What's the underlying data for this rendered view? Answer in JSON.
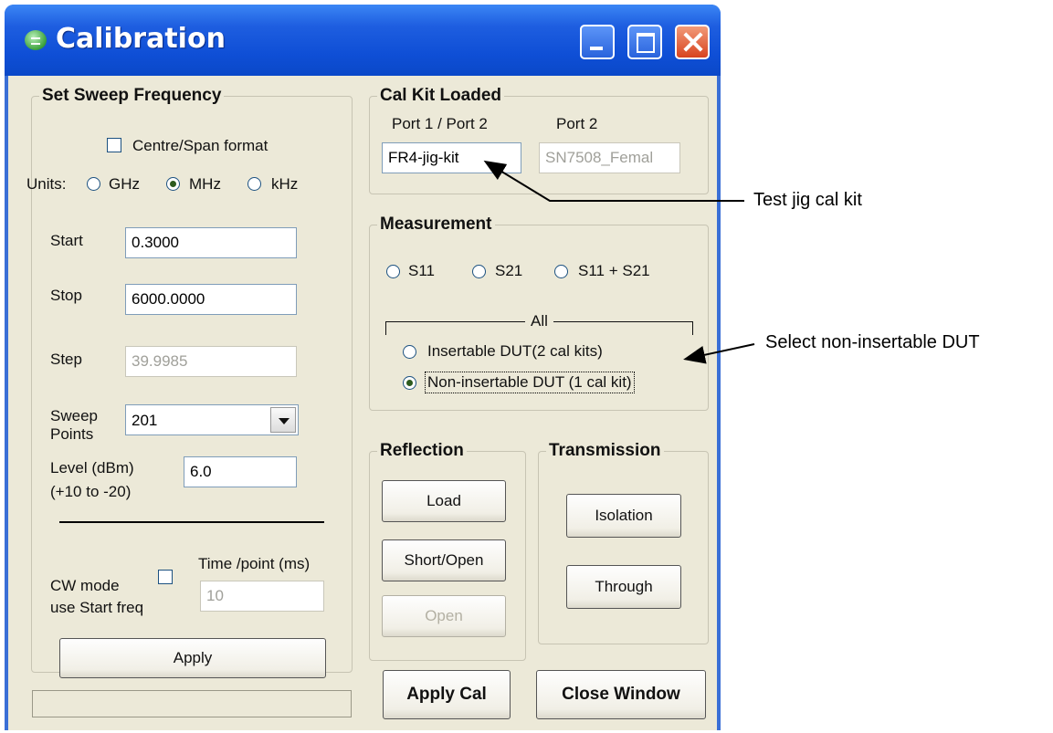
{
  "window": {
    "title": "Calibration"
  },
  "sweep": {
    "legend": "Set Sweep Frequency",
    "centre_span_label": "Centre/Span format",
    "units_label": "Units:",
    "units": [
      "GHz",
      "MHz",
      "kHz"
    ],
    "units_selected": "MHz",
    "start_label": "Start",
    "start_value": "0.3000",
    "stop_label": "Stop",
    "stop_value": "6000.0000",
    "step_label": "Step",
    "step_value": "39.9985",
    "sweep_points_label_1": "Sweep",
    "sweep_points_label_2": "Points",
    "sweep_points_value": "201",
    "level_label_1": "Level (dBm)",
    "level_label_2": "(+10 to -20)",
    "level_value": "6.0",
    "cw_label_1": "CW mode",
    "cw_label_2": "use Start freq",
    "time_label": "Time /point (ms)",
    "time_value": "10",
    "apply_label": "Apply"
  },
  "calkit": {
    "legend": "Cal Kit Loaded",
    "port1_label": "Port 1 / Port 2",
    "port2_label": "Port 2",
    "port1_value": "FR4-jig-kit",
    "port2_value": "SN7508_Femal"
  },
  "measurement": {
    "legend": "Measurement",
    "options": [
      "S11",
      "S21",
      "S11 + S21"
    ],
    "all_label": "All",
    "insertable_label": "Insertable DUT(2 cal kits)",
    "noninsertable_label": "Non-insertable DUT (1 cal kit)",
    "dut_selected": "Non-insertable DUT (1 cal kit)"
  },
  "reflection": {
    "legend": "Reflection",
    "load_label": "Load",
    "short_open_label": "Short/Open",
    "open_label": "Open"
  },
  "transmission": {
    "legend": "Transmission",
    "isolation_label": "Isolation",
    "through_label": "Through"
  },
  "footer": {
    "apply_cal_label": "Apply Cal",
    "close_window_label": "Close Window",
    "status_text": ""
  },
  "annotations": {
    "test_jig": "Test jig cal kit",
    "select_noninsertable": "Select non-insertable DUT"
  }
}
